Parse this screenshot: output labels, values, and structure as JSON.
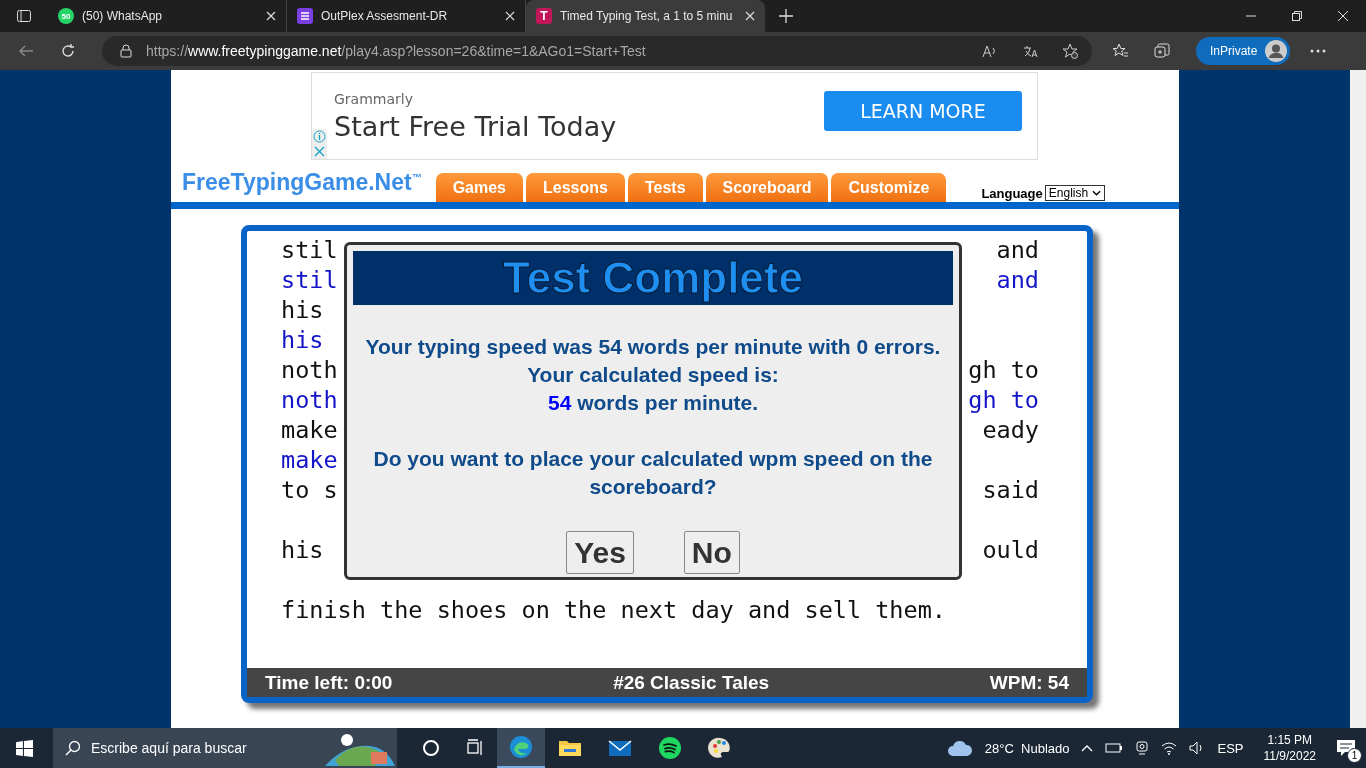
{
  "browser": {
    "tabs": [
      {
        "title": "(50) WhatsApp",
        "selected": false
      },
      {
        "title": "OutPlex Assesment-DR",
        "selected": false
      },
      {
        "title": "Timed Typing Test, a 1 to 5 minu",
        "selected": true
      }
    ],
    "tab_badge": "50",
    "tab_letter": "T",
    "url": "https://**www.freetypinggame.net**/play4.asp?lesson=26&time=1&AGo1=Start+Test",
    "profile_label": "InPrivate"
  },
  "ad": {
    "brand": "Grammarly",
    "headline": "Start Free Trial Today",
    "button": "LEARN MORE"
  },
  "site": {
    "logo": "FreeTypingGame.Net$^{™}$",
    "nav": [
      {
        "label": "Games"
      },
      {
        "label": "Lessons"
      },
      {
        "label": "Tests"
      },
      {
        "label": "Scoreboard"
      },
      {
        "label": "Customize"
      }
    ],
    "language_label": "Language",
    "language_value": "English"
  },
  "typing": {
    "lines": [
      {
        "kind": "source",
        "left": "stil",
        "right": "and"
      },
      {
        "kind": "typed",
        "left": "stil",
        "right": "and"
      },
      {
        "kind": "source",
        "left": "his"
      },
      {
        "kind": "typed",
        "left": "his"
      },
      {
        "kind": "source",
        "left": "noth",
        "right": "gh to"
      },
      {
        "kind": "typed",
        "left": "noth",
        "right": "gh to"
      },
      {
        "kind": "source",
        "left": "make",
        "right": "eady"
      },
      {
        "kind": "typed",
        "left": "make"
      },
      {
        "kind": "source",
        "left": "to s",
        "right": "said"
      },
      {
        "kind": "blank"
      },
      {
        "kind": "source",
        "left": "his",
        "right": "ould"
      },
      {
        "kind": "blank"
      },
      {
        "kind": "source",
        "left": "finish the shoes on the next day and sell them."
      }
    ],
    "status": {
      "time_left": "Time left: 0:00",
      "lesson": "#26 Classic Tales",
      "wpm": "WPM: 54"
    }
  },
  "modal": {
    "title": "Test Complete",
    "message": "Your typing speed was 54 words per minute with 0 errors. Your calculated speed is:",
    "speed_value": "54",
    "speed_unit": "words per minute.",
    "question": "Do you want to place your calculated wpm speed on the scoreboard?",
    "buttons": [
      {
        "label": "Yes"
      },
      {
        "label": "No"
      }
    ]
  },
  "taskbar": {
    "search_placeholder": "Escribe aquí para buscar",
    "weather": "28°C  Nublado",
    "language": "ESP",
    "time": "1:15 PM",
    "date": "11/9/2022",
    "notifications": "1"
  }
}
